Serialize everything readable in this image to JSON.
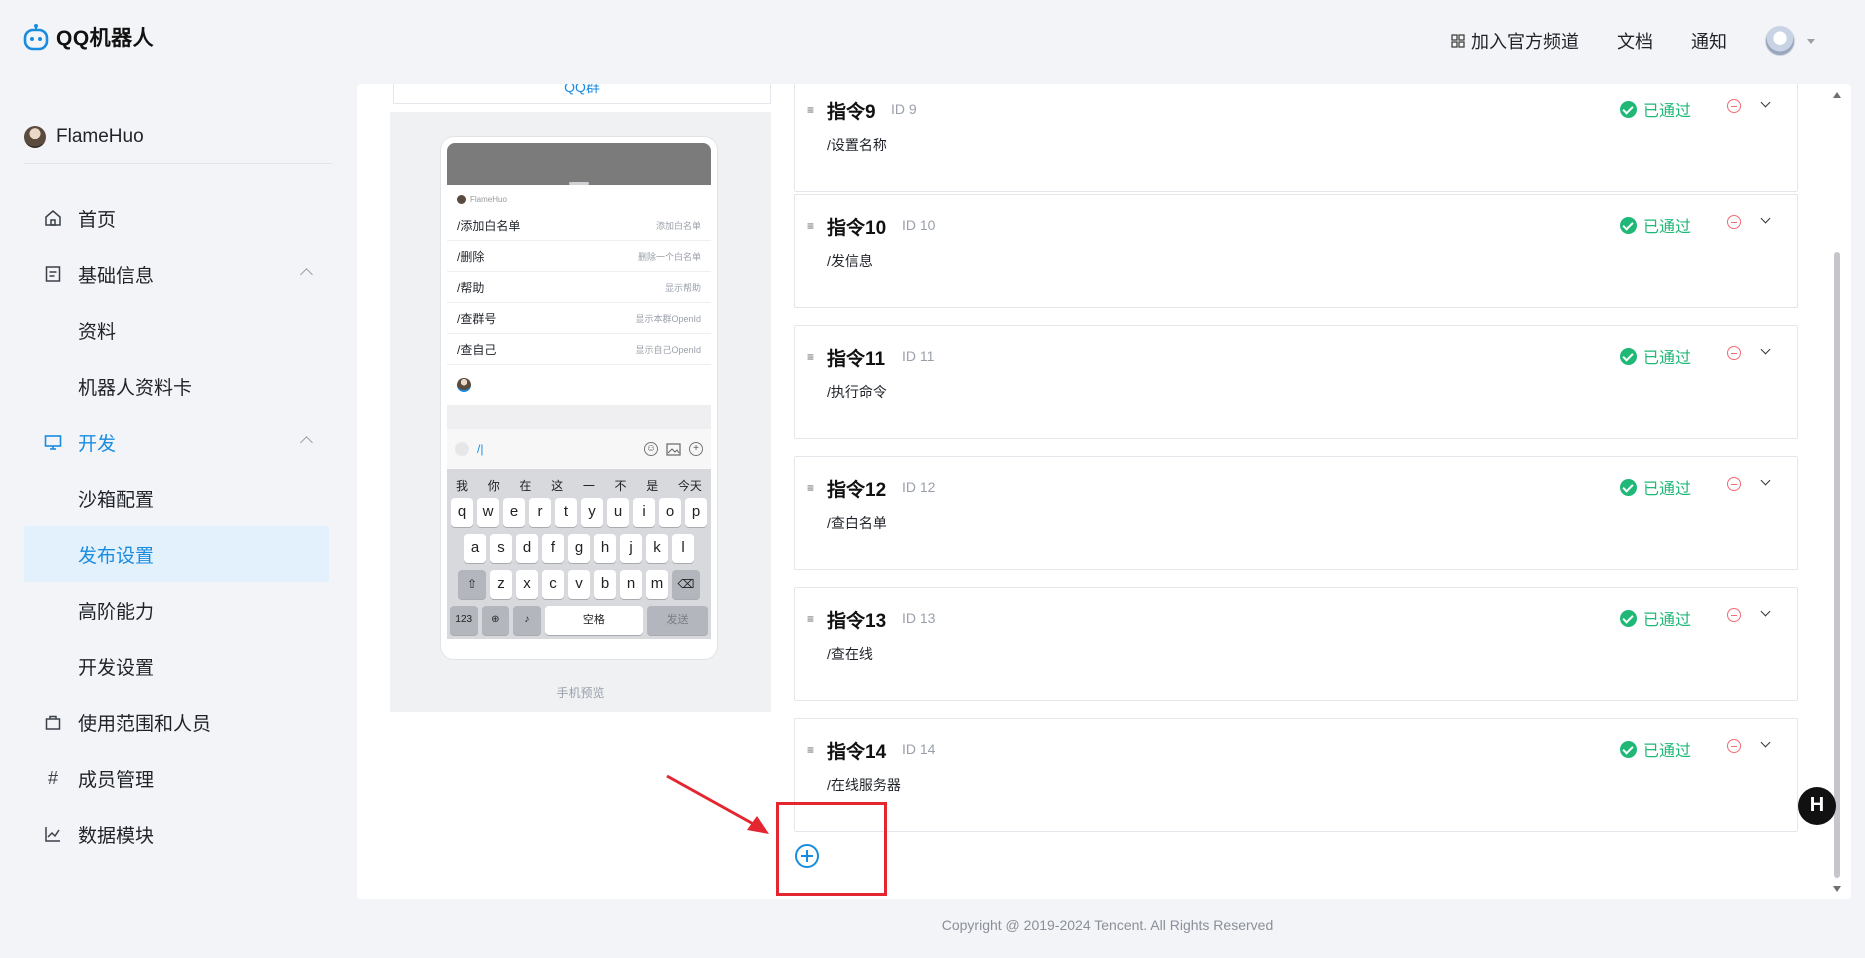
{
  "header": {
    "logo_text": "QQ机器人",
    "nav": {
      "channel": "加入官方频道",
      "docs": "文档",
      "notify": "通知"
    }
  },
  "sidebar": {
    "user_name": "FlameHuo",
    "items": [
      {
        "label": "首页",
        "icon": "home-icon"
      },
      {
        "label": "基础信息",
        "icon": "document-icon"
      },
      {
        "label": "资料"
      },
      {
        "label": "机器人资料卡"
      },
      {
        "label": "开发",
        "icon": "monitor-icon"
      },
      {
        "label": "沙箱配置"
      },
      {
        "label": "发布设置"
      },
      {
        "label": "高阶能力"
      },
      {
        "label": "开发设置"
      },
      {
        "label": "使用范围和人员",
        "icon": "bag-icon"
      },
      {
        "label": "成员管理",
        "icon": "hash-icon"
      },
      {
        "label": "数据模块",
        "icon": "chart-icon"
      }
    ]
  },
  "preview": {
    "tab_label": "QQ群",
    "bot_name": "FlameHuo",
    "commands": [
      {
        "cmd": "/添加白名单",
        "desc": "添加白名单"
      },
      {
        "cmd": "/删除",
        "desc": "删除一个白名单"
      },
      {
        "cmd": "/帮助",
        "desc": "显示帮助"
      },
      {
        "cmd": "/查群号",
        "desc": "显示本群OpenId"
      },
      {
        "cmd": "/查自己",
        "desc": "显示自己OpenId"
      }
    ],
    "input_text": "/|",
    "candidates": [
      "我",
      "你",
      "在",
      "这",
      "一",
      "不",
      "是",
      "今天"
    ],
    "row1": [
      "q",
      "w",
      "e",
      "r",
      "t",
      "y",
      "u",
      "i",
      "o",
      "p"
    ],
    "row2": [
      "a",
      "s",
      "d",
      "f",
      "g",
      "h",
      "j",
      "k",
      "l"
    ],
    "row3": [
      "z",
      "x",
      "c",
      "v",
      "b",
      "n",
      "m"
    ],
    "key_123": "123",
    "key_space": "空格",
    "key_send": "发送",
    "label": "手机预览"
  },
  "commands": [
    {
      "title": "指令9",
      "id": "ID 9",
      "cmd": "/设置名称",
      "status": "已通过"
    },
    {
      "title": "指令10",
      "id": "ID 10",
      "cmd": "/发信息",
      "status": "已通过"
    },
    {
      "title": "指令11",
      "id": "ID 11",
      "cmd": "/执行命令",
      "status": "已通过"
    },
    {
      "title": "指令12",
      "id": "ID 12",
      "cmd": "/查白名单",
      "status": "已通过"
    },
    {
      "title": "指令13",
      "id": "ID 13",
      "cmd": "/查在线",
      "status": "已通过"
    },
    {
      "title": "指令14",
      "id": "ID 14",
      "cmd": "/在线服务器",
      "status": "已通过"
    }
  ],
  "float_badge": "H",
  "footer": "Copyright @ 2019-2024 Tencent. All Rights Reserved",
  "colors": {
    "accent": "#1a8ce0",
    "success": "#1fb877",
    "danger": "#f06a73",
    "annotation": "#e3262f"
  }
}
